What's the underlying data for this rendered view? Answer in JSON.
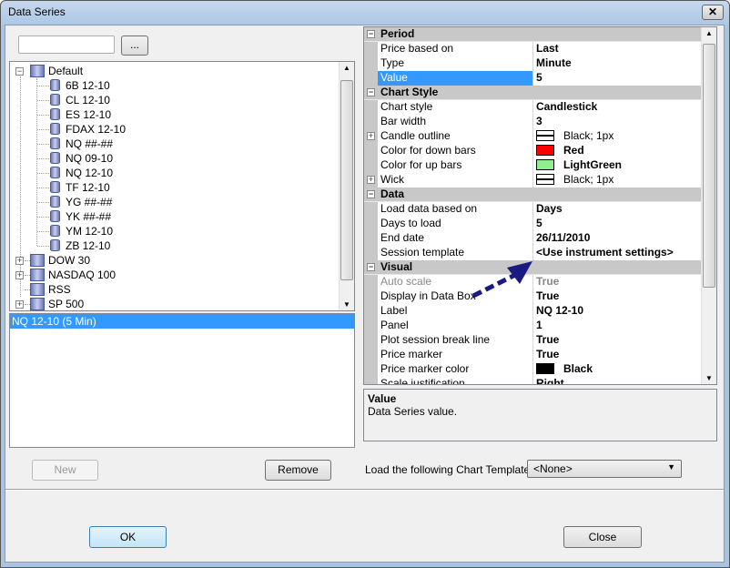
{
  "window": {
    "title": "Data Series",
    "close": "✕"
  },
  "search": {
    "value": "",
    "browse_label": "..."
  },
  "tree": {
    "root": "Default",
    "children": [
      "6B 12-10",
      "CL 12-10",
      "ES 12-10",
      "FDAX 12-10",
      "NQ ##-##",
      "NQ 09-10",
      "NQ 12-10",
      "TF 12-10",
      "YG ##-##",
      "YK ##-##",
      "YM 12-10",
      "ZB 12-10"
    ],
    "others": [
      "DOW 30",
      "NASDAQ 100",
      "RSS",
      "SP 500"
    ]
  },
  "selected_series": [
    "NQ 12-10 (5 Min)"
  ],
  "buttons": {
    "new": "New",
    "remove": "Remove",
    "ok": "OK",
    "close": "Close"
  },
  "template": {
    "label": "Load the following Chart Template:",
    "value": "<None>"
  },
  "properties": [
    {
      "cat": "Period"
    },
    {
      "name": "Price based on",
      "value": "Last"
    },
    {
      "name": "Type",
      "value": "Minute"
    },
    {
      "name": "Value",
      "value": "5",
      "selected": true
    },
    {
      "cat": "Chart Style"
    },
    {
      "name": "Chart style",
      "value": "Candlestick"
    },
    {
      "name": "Bar width",
      "value": "3"
    },
    {
      "name": "Candle outline",
      "value": "Black; 1px",
      "swatch": "stroke",
      "expand": true
    },
    {
      "name": "Color for down bars",
      "value": "Red",
      "swatch": "#ff0000"
    },
    {
      "name": "Color for up bars",
      "value": "LightGreen",
      "swatch": "#90ee90"
    },
    {
      "name": "Wick",
      "value": "Black; 1px",
      "swatch": "stroke",
      "expand": true
    },
    {
      "cat": "Data"
    },
    {
      "name": "Load data based on",
      "value": "Days"
    },
    {
      "name": "Days to load",
      "value": "5"
    },
    {
      "name": "End date",
      "value": "26/11/2010"
    },
    {
      "name": "Session template",
      "value": "<Use instrument settings>"
    },
    {
      "cat": "Visual"
    },
    {
      "name": "Auto scale",
      "value": "True",
      "disabled": true
    },
    {
      "name": "Display in Data Box",
      "value": "True"
    },
    {
      "name": "Label",
      "value": "NQ 12-10"
    },
    {
      "name": "Panel",
      "value": "1"
    },
    {
      "name": "Plot session break line",
      "value": "True"
    },
    {
      "name": "Price marker",
      "value": "True"
    },
    {
      "name": "Price marker color",
      "value": "Black",
      "swatch": "#000000"
    },
    {
      "name": "Scale justification",
      "value": "Right"
    }
  ],
  "description": {
    "title": "Value",
    "text": "Data Series value."
  }
}
